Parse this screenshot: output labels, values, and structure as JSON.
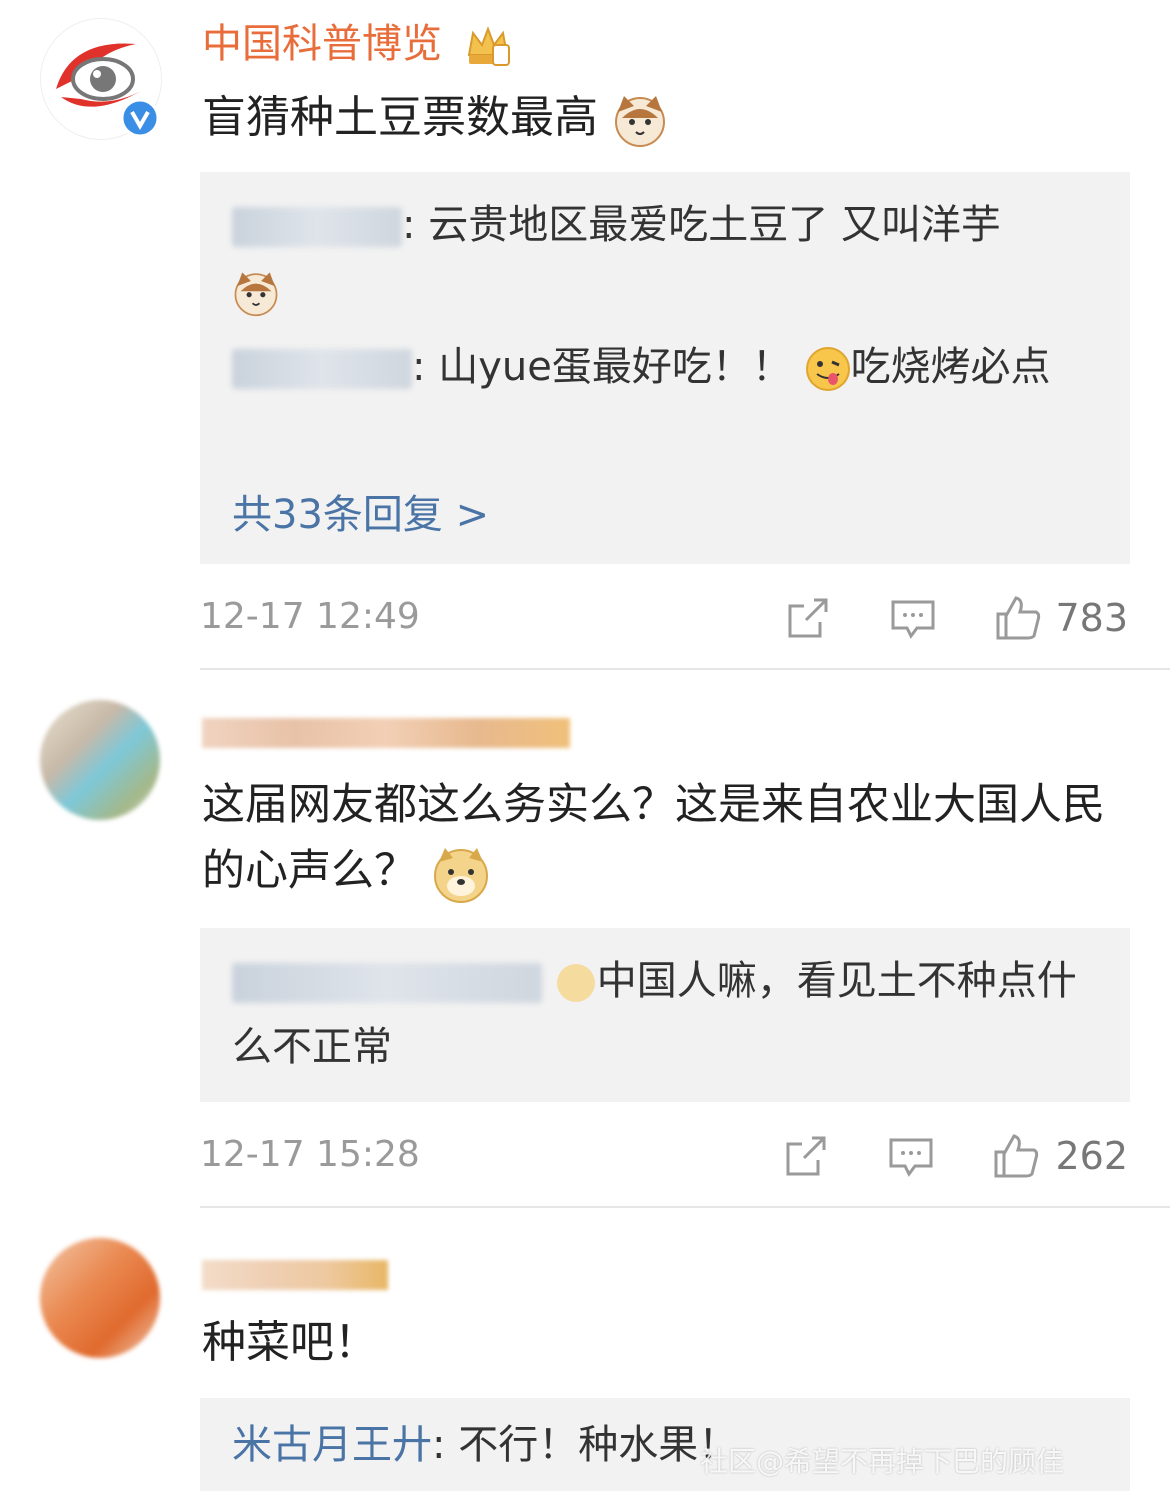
{
  "comments": [
    {
      "user": "中国科普博览",
      "text": "盲猜种土豆票数最高",
      "replies": [
        {
          "user": "易峰笔记",
          "text": "云贵地区最爱吃土豆了 又叫洋芋"
        },
        {
          "user": "用户",
          "text_a": "山yue蛋最好吃！！",
          "text_b": "吃烧烤必点"
        }
      ],
      "more_replies": "共33条回复 >",
      "time": "12-17 12:49",
      "likes": "783"
    },
    {
      "user": "",
      "text": "这届网友都这么务实么？这是来自农业大国人民的心声么？",
      "replies": [
        {
          "user": "",
          "text": "中国人嘛，看见土不种点什么不正常"
        }
      ],
      "time": "12-17 15:28",
      "likes": "262"
    },
    {
      "user": "",
      "text": "种菜吧！",
      "replies": [
        {
          "user": "米古月王廾",
          "text": "不行！种水果！"
        }
      ]
    }
  ],
  "watermark": "社区@希望不再掉下巴的顾佳",
  "icons": [
    "share-icon",
    "comment-icon",
    "like-icon",
    "verified-icon",
    "crown-icon",
    "cat-emoji-icon",
    "tongue-emoji-icon",
    "doge-emoji-icon"
  ],
  "colors": {
    "name_orange": "#e86d3a",
    "link_blue": "#4a73a6",
    "reply_bg": "#f2f2f2",
    "meta_gray": "#9a9a9a"
  }
}
